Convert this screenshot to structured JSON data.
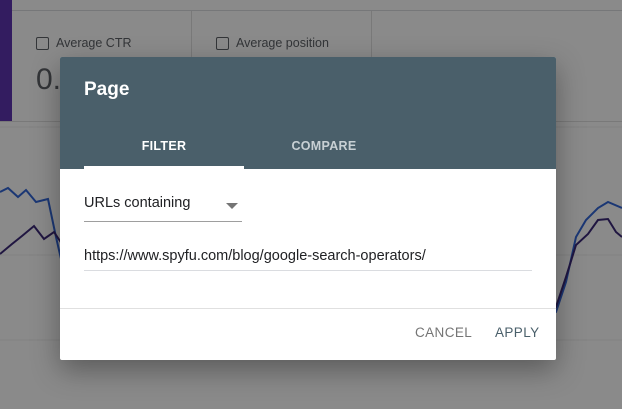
{
  "background": {
    "metrics": [
      {
        "label": "Average CTR",
        "value": "0."
      },
      {
        "label": "Average position",
        "value": ""
      }
    ],
    "accent_color": "#5e35b1",
    "series_colors": [
      "#3367d6",
      "#3c2a78"
    ]
  },
  "dialog": {
    "title": "Page",
    "header_color": "#4a5f6a",
    "tabs": [
      {
        "label": "FILTER",
        "active": true
      },
      {
        "label": "COMPARE",
        "active": false
      }
    ],
    "filter": {
      "match_type": "URLs containing",
      "value": "https://www.spyfu.com/blog/google-search-operators/"
    },
    "actions": {
      "cancel_label": "CANCEL",
      "apply_label": "APPLY"
    }
  }
}
